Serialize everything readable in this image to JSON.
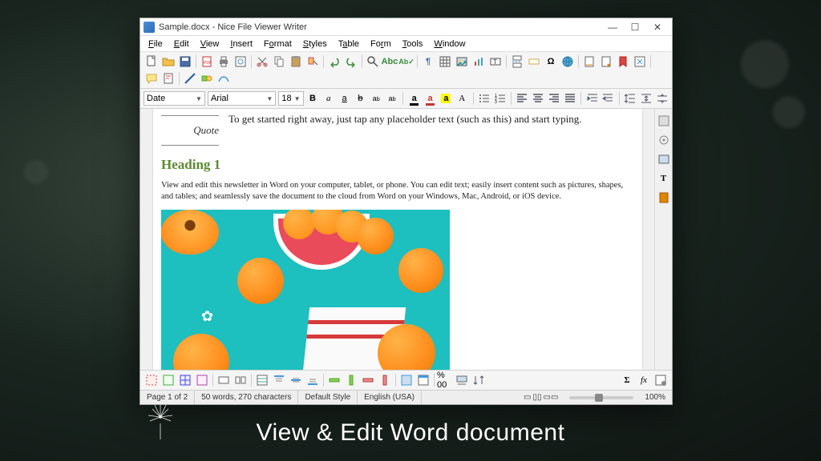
{
  "caption": "View & Edit Word document",
  "window": {
    "title": "Sample.docx - Nice File Viewer Writer"
  },
  "menu": [
    "File",
    "Edit",
    "View",
    "Insert",
    "Format",
    "Styles",
    "Table",
    "Form",
    "Tools",
    "Window"
  ],
  "format_bar": {
    "style": "Date",
    "font": "Arial",
    "size": "18"
  },
  "document": {
    "quote_label": "Quote",
    "intro": "To get started right away, just tap any placeholder text (such as this) and start typing.",
    "heading1": "Heading 1",
    "body1": "View and edit this newsletter in Word on your computer, tablet, or phone. You can edit text; easily insert content such as pictures, shapes, and tables; and seamlessly save the document to the cloud from Word on your Windows, Mac, Android, or iOS device."
  },
  "status": {
    "page": "Page 1 of 2",
    "words": "50 words, 270 characters",
    "style": "Default Style",
    "lang": "English (USA)",
    "zoom_pct": "% 00",
    "zoom_label": "100%"
  }
}
